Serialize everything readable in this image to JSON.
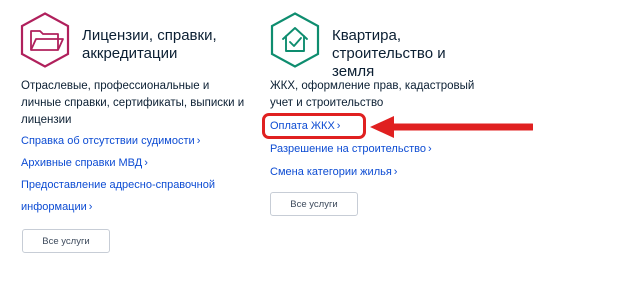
{
  "left": {
    "title_line1": "Лицензии, справки,",
    "title_line2": "аккредитации",
    "desc_line1": "Отраслевые, профессиональные и",
    "desc_line2": "личные справки, сертификаты, выписки и",
    "desc_line3": "лицензии",
    "links": [
      {
        "label": "Справка об отсутствии судимости"
      },
      {
        "label": "Архивные справки МВД"
      },
      {
        "label_line1": "Предоставление адресно-справочной",
        "label_line2": "информации"
      }
    ],
    "button": "Все услуги",
    "icon": "folder-icon",
    "accent": "#b0205c"
  },
  "right": {
    "title_line1": "Квартира,",
    "title_line2": "строительство и",
    "title_line3": "земля",
    "desc_line1": "ЖКХ, оформление прав, кадастровый",
    "desc_line2": "учет и строительство",
    "links": [
      {
        "label": "Оплата ЖКХ"
      },
      {
        "label": "Разрешение на строительство"
      },
      {
        "label": "Смена категории жилья"
      }
    ],
    "button": "Все услуги",
    "icon": "house-check-icon",
    "accent": "#0e8d6f"
  },
  "chevron": "›",
  "annotation": {
    "highlight_color": "#e02020",
    "arrow_color": "#e02020"
  }
}
